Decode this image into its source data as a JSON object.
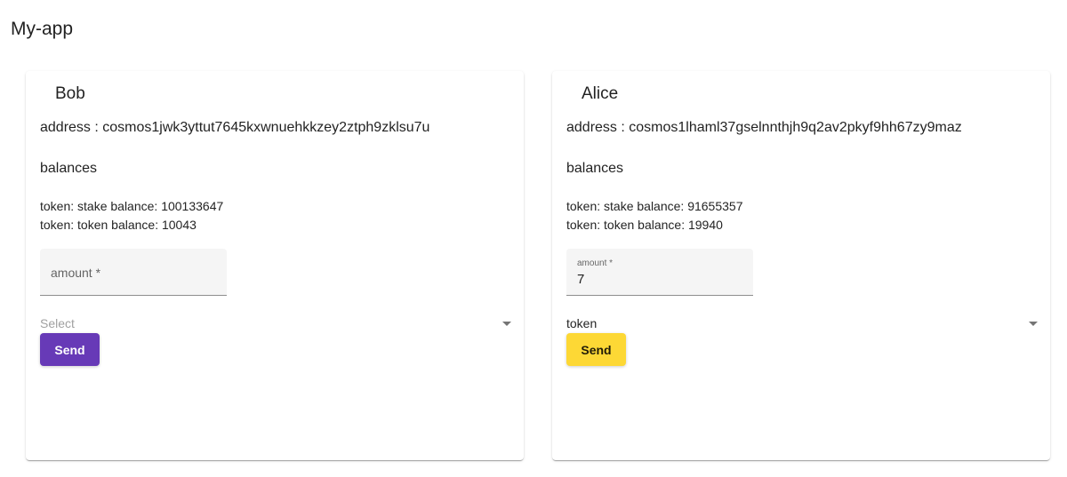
{
  "app": {
    "title": "My-app"
  },
  "accounts": [
    {
      "name": "Bob",
      "address_text": "address : cosmos1jwk3yttut7645kxwnuehkkzey2ztph9zklsu7u",
      "balances_title": "balances",
      "balances": [
        "token: stake balance: 100133647",
        "token: token balance: 10043"
      ],
      "amount_label": "amount *",
      "amount_value": "",
      "select_text": "Select",
      "send_label": "Send",
      "send_color": "#673ab7"
    },
    {
      "name": "Alice",
      "address_text": "address : cosmos1lhaml37gselnnthjh9q2av2pkyf9hh67zy9maz",
      "balances_title": "balances",
      "balances": [
        "token: stake balance: 91655357",
        "token: token balance: 19940"
      ],
      "amount_label": "amount *",
      "amount_value": "7",
      "select_text": "token",
      "send_label": "Send",
      "send_color": "#fdd835"
    }
  ],
  "icons": {
    "select_arrow": "chevron-down-icon"
  }
}
